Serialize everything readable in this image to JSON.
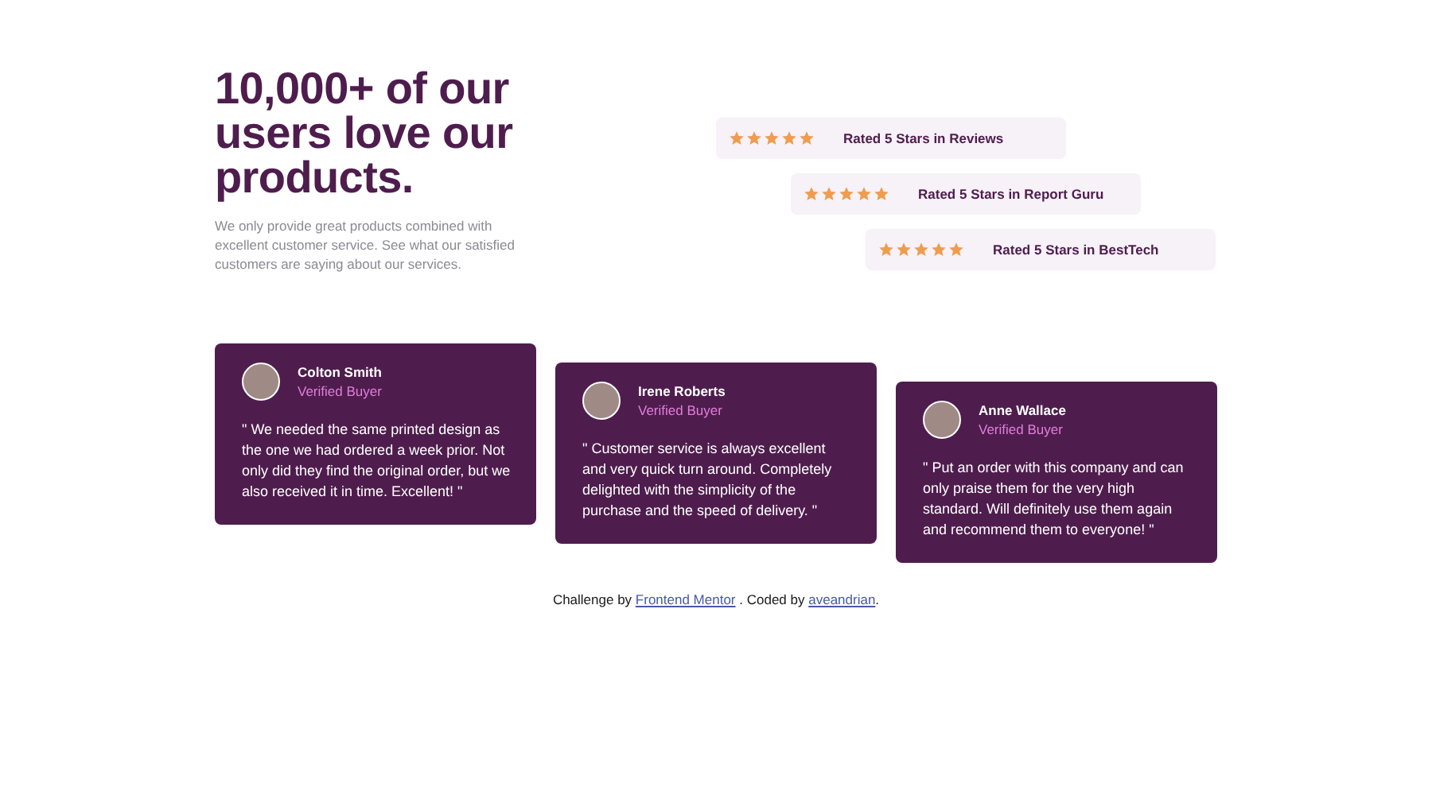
{
  "hero": {
    "heading": "10,000+ of our users love our products.",
    "description": "We only provide great products combined with excellent customer service. See what our satisfied customers are saying about our services."
  },
  "ratings": [
    {
      "stars": 5,
      "label": "Rated 5 Stars in Reviews"
    },
    {
      "stars": 5,
      "label": "Rated 5 Stars in Report Guru"
    },
    {
      "stars": 5,
      "label": "Rated 5 Stars in BestTech"
    }
  ],
  "testimonials": [
    {
      "name": "Colton Smith",
      "role": "Verified Buyer",
      "quote": "\" We needed the same printed design as the one we had ordered a week prior. Not only did they find the original order, but we also received it in time. Excellent! \""
    },
    {
      "name": "Irene Roberts",
      "role": "Verified Buyer",
      "quote": "\" Customer service is always excellent and very quick turn around. Completely delighted with the simplicity of the purchase and the speed of delivery. \""
    },
    {
      "name": "Anne Wallace",
      "role": "Verified Buyer",
      "quote": "\" Put an order with this company and can only praise them for the very high standard. Will definitely use them again and recommend them to everyone! \""
    }
  ],
  "footer": {
    "prefix": "Challenge by ",
    "link_1": "Frontend Mentor",
    "middle": " . Coded by ",
    "link_2": "aveandrian",
    "suffix": "."
  }
}
